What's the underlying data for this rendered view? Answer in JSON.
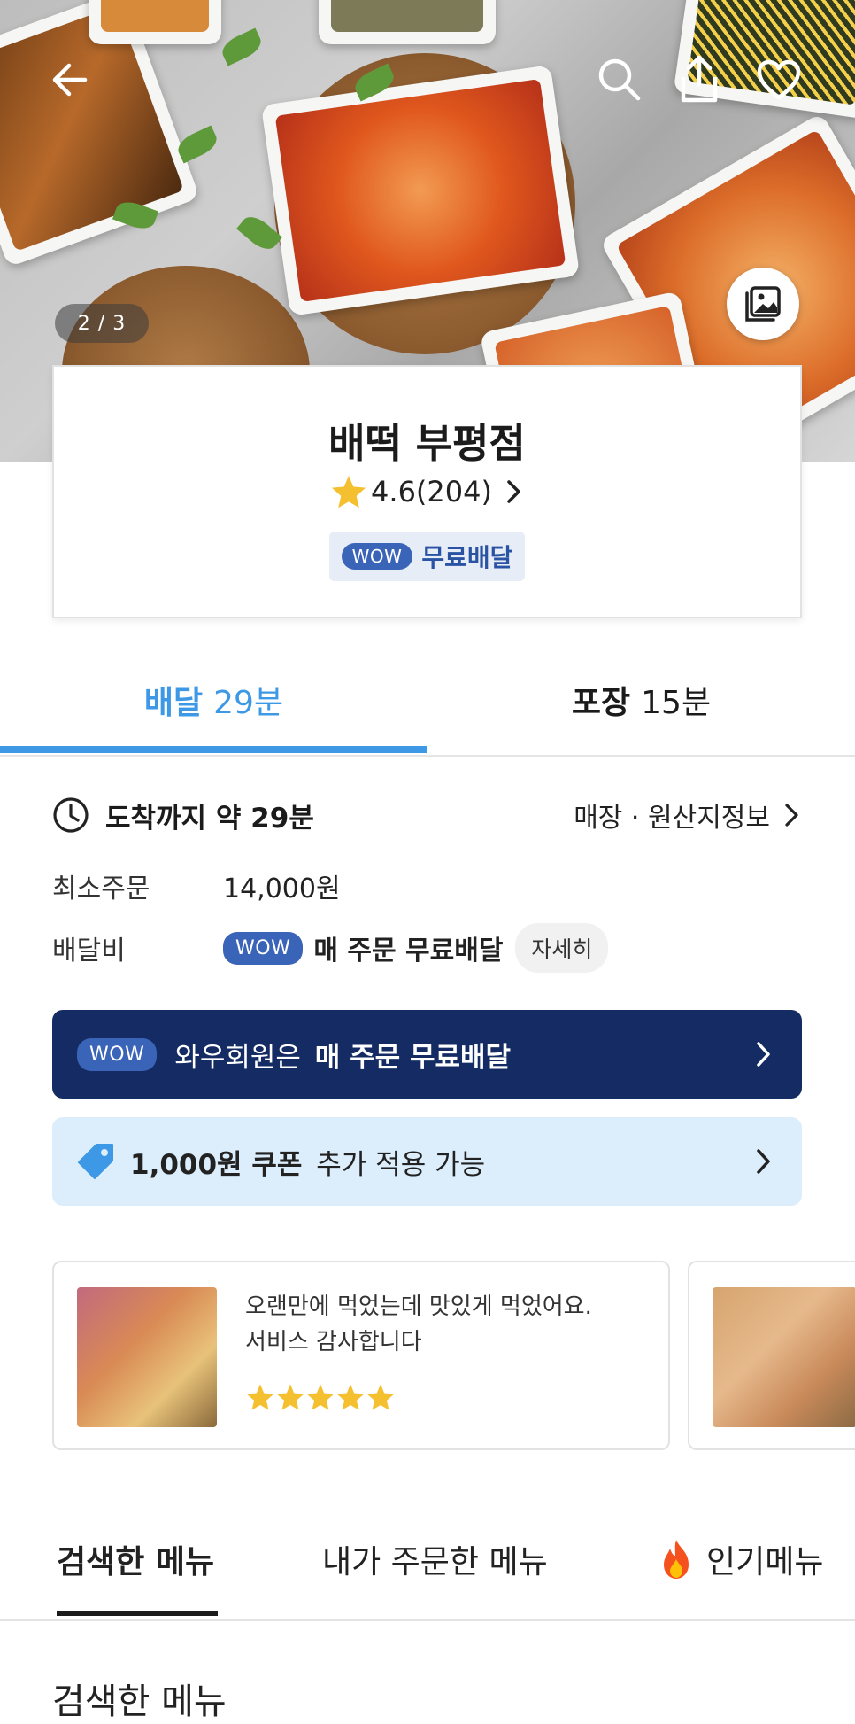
{
  "hero": {
    "counter": "2 / 3",
    "icons": [
      "back-arrow-icon",
      "search-icon",
      "share-icon",
      "heart-icon",
      "gallery-icon"
    ]
  },
  "store": {
    "name": "배떡 부평점",
    "rating": "4.6",
    "review_count": "(204)",
    "wow_label": "WOW",
    "free_delivery": "무료배달"
  },
  "tabs": {
    "delivery_label": "배달",
    "delivery_time": "29분",
    "pickup_label": "포장",
    "pickup_time": "15분",
    "active": "delivery"
  },
  "info": {
    "eta": "도착까지 약 29분",
    "origin_link": "매장 · 원산지정보",
    "min_order_label": "최소주문",
    "min_order_value": "14,000원",
    "delivery_fee_label": "배달비",
    "delivery_fee_wow": "WOW",
    "delivery_fee_value": "매 주문 무료배달",
    "detail_button": "자세히"
  },
  "wow_banner": {
    "pill": "WOW",
    "text_prefix": "와우회원은",
    "text_bold": "매 주문 무료배달"
  },
  "coupon_banner": {
    "bold": "1,000원 쿠폰",
    "text": "추가 적용 가능"
  },
  "reviews": [
    {
      "line1": "오랜만에 먹었는데 맛있게 먹었어요.",
      "line2": "서비스 감사합니다",
      "stars": 5
    }
  ],
  "menu_tabs": {
    "searched": "검색한 메뉴",
    "ordered": "내가 주문한 메뉴",
    "popular": "인기메뉴"
  },
  "section_title": "검색한 메뉴",
  "colors": {
    "accent_blue": "#3d98e5",
    "wow_navy": "#142c63",
    "wow_pill": "#3a64b8",
    "coupon_bg": "#dcedfb",
    "star": "#f5c02f"
  }
}
